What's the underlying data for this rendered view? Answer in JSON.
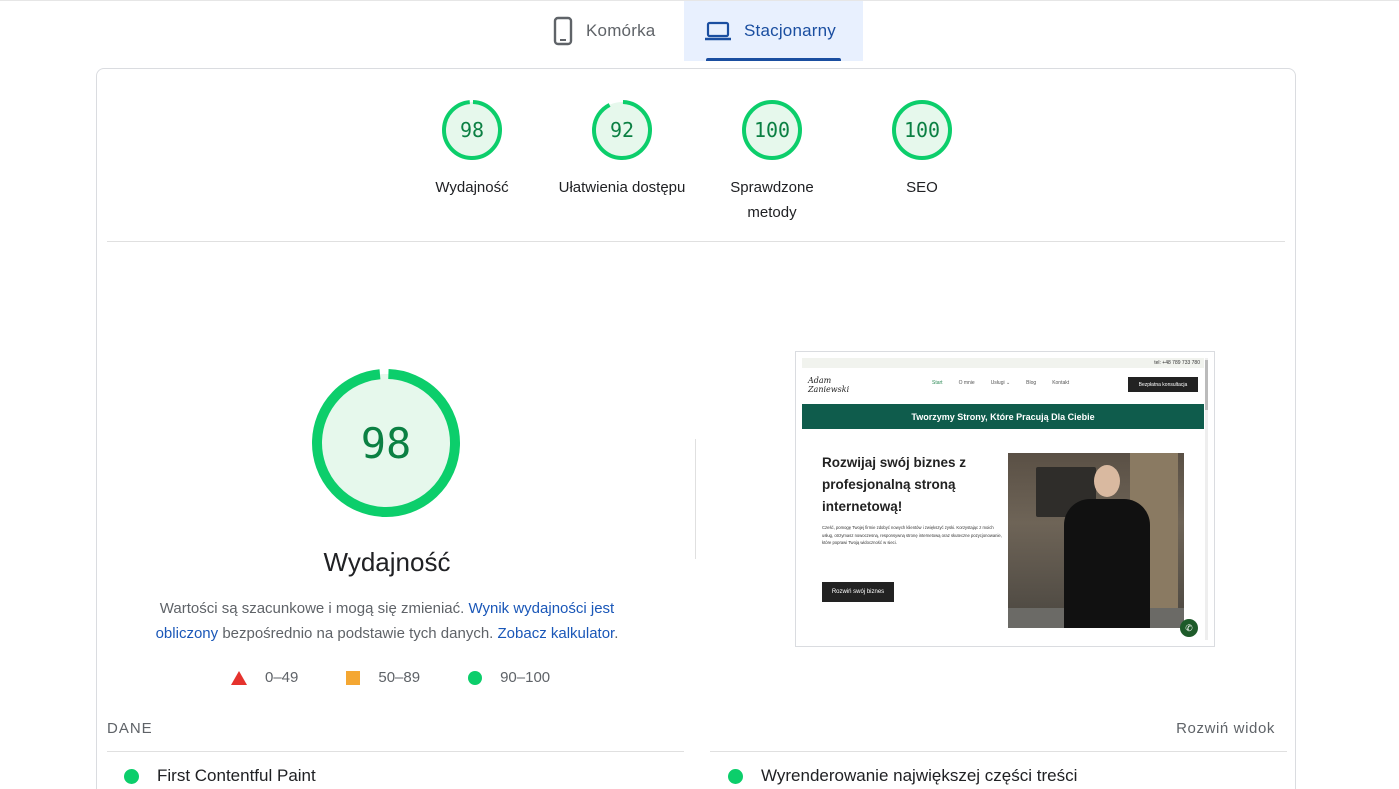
{
  "tabs": [
    {
      "label": "Komórka",
      "icon": "phone-icon",
      "active": false
    },
    {
      "label": "Stacjonarny",
      "icon": "laptop-icon",
      "active": true
    }
  ],
  "colors": {
    "pass": "#0cce6b",
    "pass_text": "#0b8043",
    "average": "#f4a732",
    "fail": "#e5322d",
    "link": "#1a57b8",
    "active_tab_bg": "#e8f0fe"
  },
  "gauges": [
    {
      "score": "98",
      "label": "Wydajność"
    },
    {
      "score": "92",
      "label": "Ułatwienia dostępu"
    },
    {
      "score": "100",
      "label": "Sprawdzone metody"
    },
    {
      "score": "100",
      "label": "SEO"
    }
  ],
  "performance": {
    "score": "98",
    "title": "Wydajność",
    "desc_prefix": "Wartości są szacunkowe i mogą się zmieniać.",
    "desc_link1": "Wynik wydajności jest obliczony",
    "desc_middle": "bezpośrednio na podstawie tych danych.",
    "desc_link2": "Zobacz kalkulator",
    "desc_suffix": "."
  },
  "legend": [
    {
      "range": "0–49",
      "icon": "red-triangle-icon"
    },
    {
      "range": "50–89",
      "icon": "orange-square-icon"
    },
    {
      "range": "90–100",
      "icon": "green-circle-icon"
    }
  ],
  "preview": {
    "phone": "tel: +48 789 733 780",
    "logo": "Adam Zaniewski",
    "nav": [
      "Start",
      "O mnie",
      "Usługi ⌄",
      "Blog",
      "Kontakt"
    ],
    "cta": "Bezpłatna konsultacja",
    "banner": "Tworzymy Strony, Które Pracują Dla Ciebie",
    "heading": "Rozwijaj swój biznes z profesjonalną stroną internetową!",
    "text": "Cześć, pomogę Twojej firmie zdobyć nowych klientów i zwiększyć zyski. Korzystając z moich usług, otrzymasz nowoczesną, responsywną stronę internetową oraz skuteczne pozycjonowanie, które poprawi Twoją widoczność w sieci.",
    "button": "Rozwiń swój biznes"
  },
  "data_section": {
    "title": "DANE",
    "expand": "Rozwiń widok",
    "metrics": [
      {
        "label": "First Contentful Paint"
      },
      {
        "label": "Wyrenderowanie największej części treści"
      }
    ]
  }
}
